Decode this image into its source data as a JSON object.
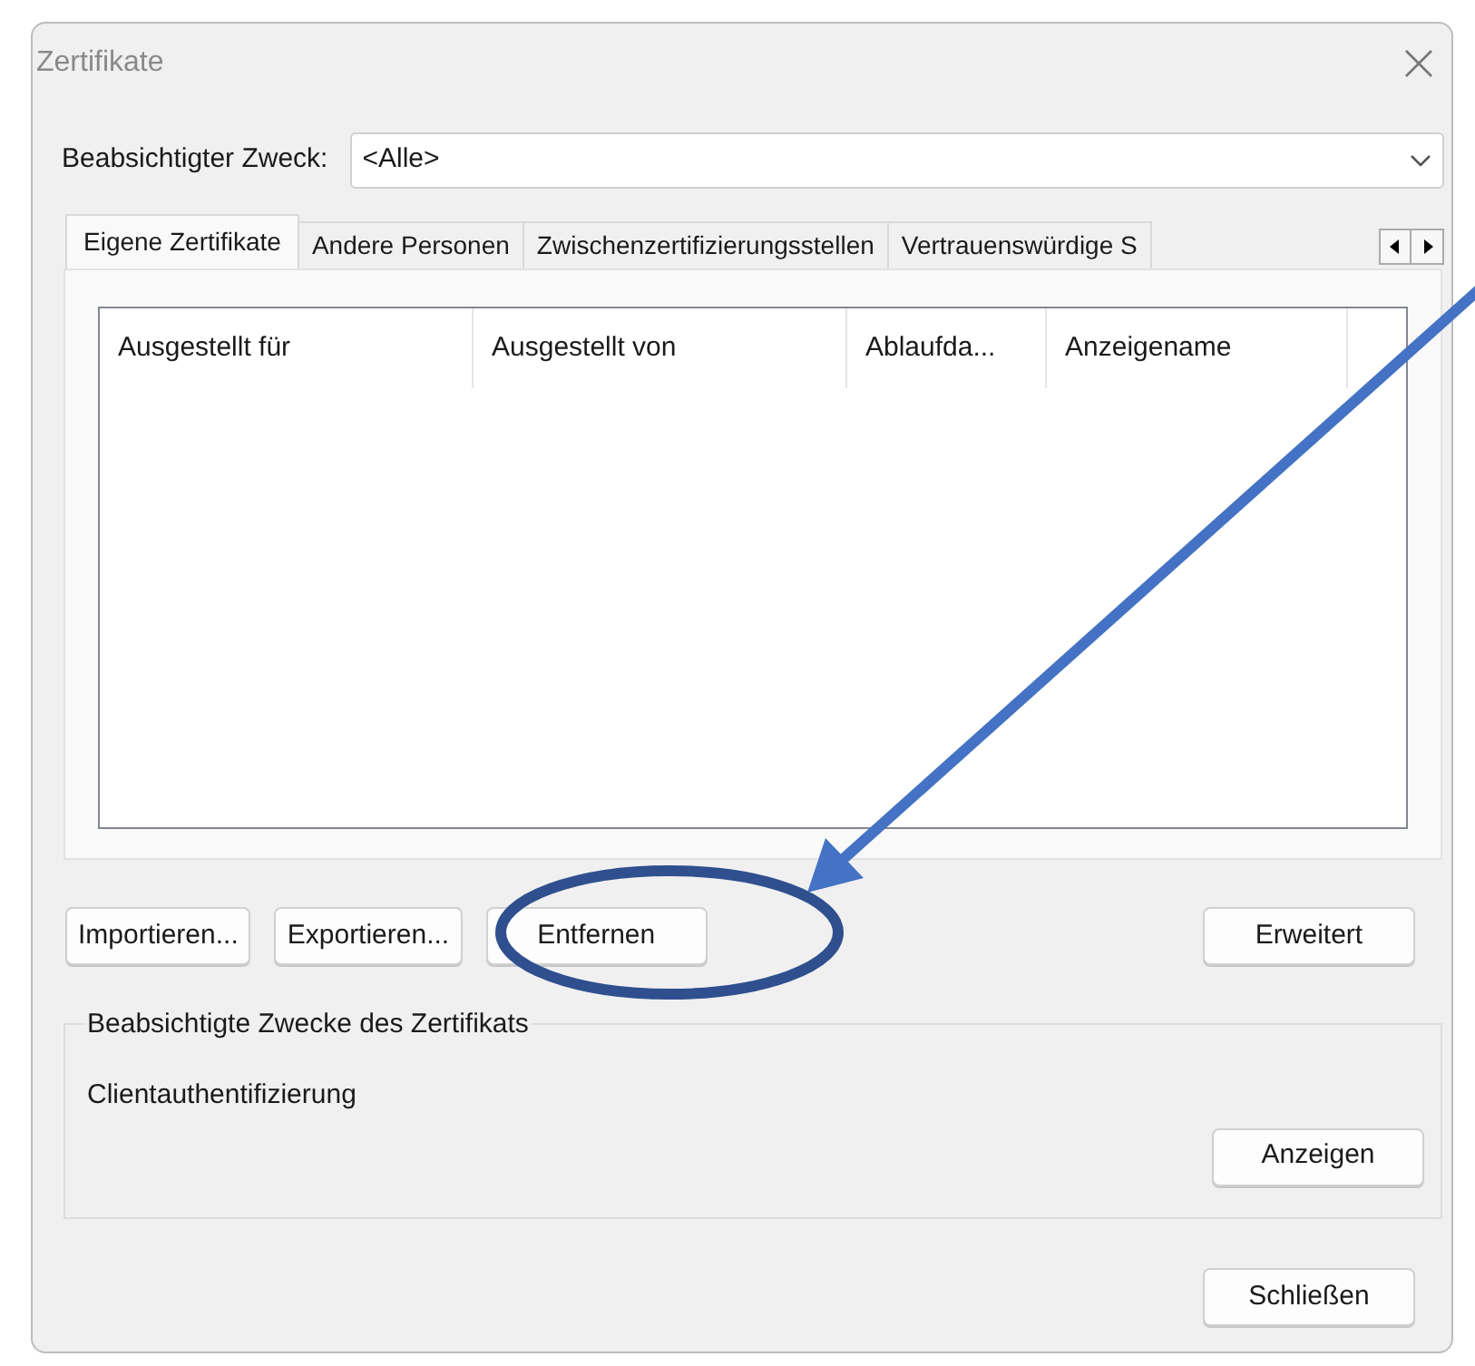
{
  "window": {
    "title": "Zertifikate"
  },
  "purpose": {
    "label": "Beabsichtigter Zweck:",
    "value": "<Alle>"
  },
  "tabs": [
    {
      "label": "Eigene Zertifikate",
      "selected": true
    },
    {
      "label": "Andere Personen",
      "selected": false
    },
    {
      "label": "Zwischenzertifizierungsstellen",
      "selected": false
    },
    {
      "label": "Vertrauenswürdige S",
      "selected": false
    }
  ],
  "table": {
    "columns": [
      "Ausgestellt für",
      "Ausgestellt von",
      "Ablaufda...",
      "Anzeigename"
    ]
  },
  "actions": [
    "Importieren...",
    "Exportieren...",
    "Entfernen"
  ],
  "advanced_button": "Erweitert",
  "purposes_group": {
    "title": "Beabsichtigte Zwecke des Zertifikats",
    "text": "Clientauthentifizierung",
    "button": "Anzeigen"
  },
  "close_button": "Schließen"
}
